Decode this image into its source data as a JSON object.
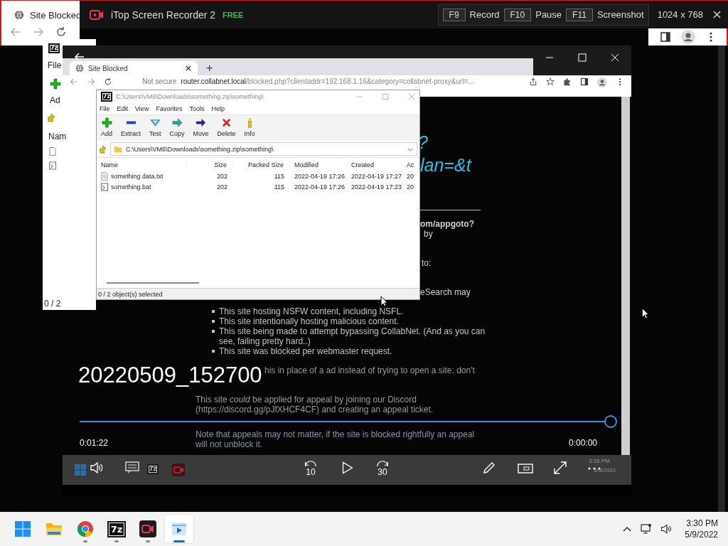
{
  "outer_browser": {
    "tab_title": "Site Blocked"
  },
  "recorder_bar": {
    "app_name": "iTop Screen Recorder 2",
    "badge": "FREE",
    "hotkeys": [
      {
        "key": "F9",
        "action": "Record"
      },
      {
        "key": "F10",
        "action": "Pause"
      },
      {
        "key": "F11",
        "action": "Screenshot"
      }
    ],
    "resolution": "1024 x 768"
  },
  "background_archive_window": {
    "icon_text": "7z",
    "menu_item": "File",
    "toolbar_label": "Ad",
    "column_header": "Nam",
    "status": "0 / 2"
  },
  "player": {
    "title": "20220509_152700",
    "elapsed": "0:01:22",
    "remaining": "0:00:00",
    "level": 1,
    "rewind_seconds": "10",
    "forward_seconds": "30"
  },
  "recording": {
    "browser": {
      "tab_title": "Site Blocked",
      "new_tab": "+",
      "security": "Not secure",
      "url_host": "router.collabnet.local",
      "url_path": "/blocked.php?clientaddr=192.168.1.16&category=collabnet-proxy&url=..."
    },
    "archive_window": {
      "icon_text": "7z",
      "title": "C:\\Users\\VM6\\Downloads\\something.zip\\something\\",
      "menu": [
        "File",
        "Edit",
        "View",
        "Favorites",
        "Tools",
        "Help"
      ],
      "toolbar": [
        {
          "label": "Add",
          "kind": "add"
        },
        {
          "label": "Extract",
          "kind": "extract"
        },
        {
          "label": "Test",
          "kind": "test"
        },
        {
          "label": "Copy",
          "kind": "copy"
        },
        {
          "label": "Move",
          "kind": "move"
        },
        {
          "label": "Delete",
          "kind": "delete"
        },
        {
          "label": "Info",
          "kind": "info"
        }
      ],
      "path": "C:\\Users\\VM6\\Downloads\\something.zip\\something\\",
      "columns": [
        "Name",
        "Size",
        "Packed Size",
        "Modified",
        "Created",
        "Ac"
      ],
      "rows": [
        {
          "kind": "text",
          "cells": [
            "something data.txt",
            "202",
            "115",
            "2022-04-19 17:26",
            "2022-04-19 17:27",
            "20"
          ]
        },
        {
          "kind": "batch",
          "cells": [
            "something.bat",
            "202",
            "115",
            "2022-04-19 17:26",
            "2022-04-19 17:23",
            "20"
          ]
        }
      ],
      "status": "0 / 2 object(s) selected"
    },
    "page": {
      "heading_fragments": [
        "?",
        "lan=&t"
      ],
      "link_fragment": "om/appgoto?",
      "by_fragment": "by",
      "to_fragment": "to:",
      "search_fragment": "eSearch may",
      "bullets": [
        "This site hosting NSFW content, including NSFL.",
        "This site intentionally hosting malicious content.",
        "This site being made to attempt bypassing CollabNet. (And as you can see, failing pretty hard..)",
        "This site was blocked per webmaster request."
      ],
      "partial_paragraph": "his in place of a ad instead of trying to open a site: don't",
      "appeal_paragraph": "This site *could* be applied for appeal by joining our Discord (https://discord.gg/pJfXHCF4CF) and creating an appeal ticket.",
      "note_paragraph": "Note that appeals may not matter, if the site is blocked rightfully an appeal will not unblock it."
    },
    "taskbar": {
      "icon_text": "7z",
      "time": "3:28 PM",
      "date": "5/9/2022"
    }
  },
  "taskbar": {
    "apps": [
      {
        "kind": "start",
        "running": false,
        "selected": false
      },
      {
        "kind": "folder",
        "running": false,
        "selected": false
      },
      {
        "kind": "browser",
        "running": true,
        "selected": false
      },
      {
        "kind": "archiver",
        "icon_text": "7z",
        "running": true,
        "selected": false
      },
      {
        "kind": "recorder",
        "running": true,
        "selected": false
      },
      {
        "kind": "player",
        "running": true,
        "selected": true
      }
    ],
    "time": "3:30 PM",
    "date": "5/9/2022"
  }
}
